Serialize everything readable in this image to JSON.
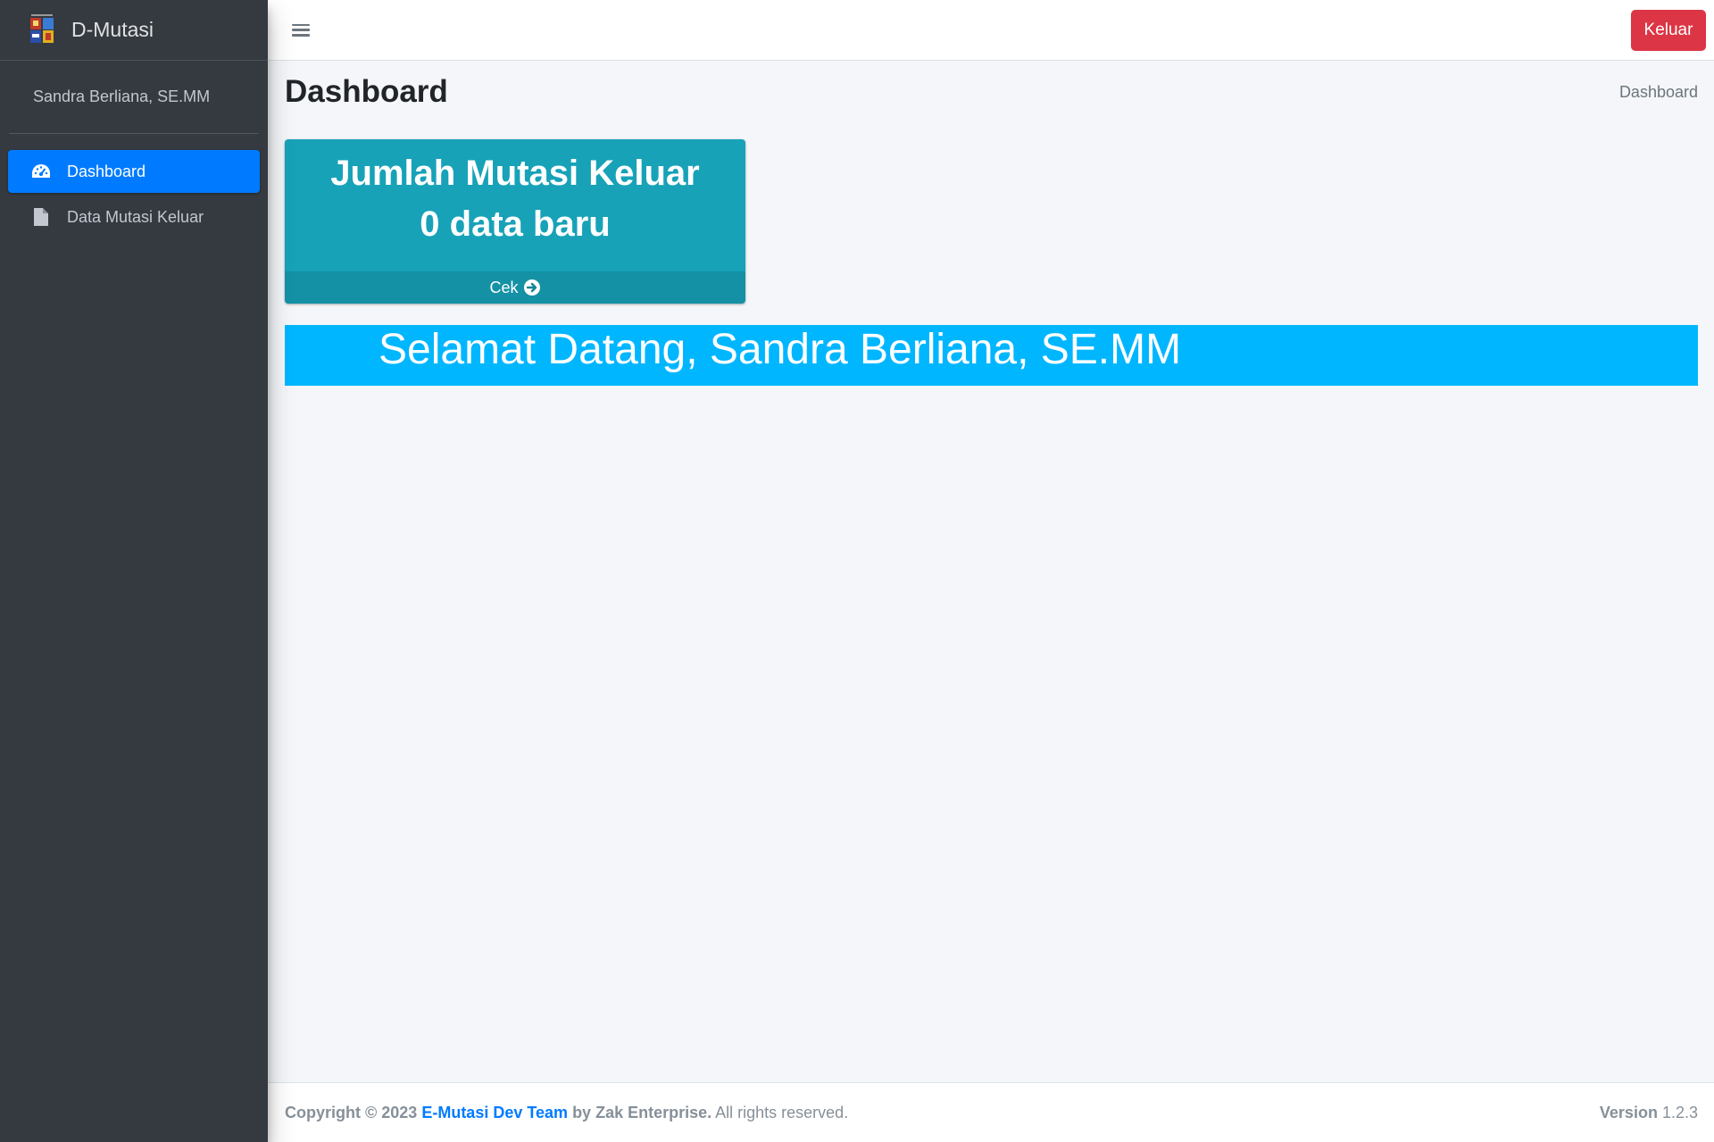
{
  "app": {
    "brand": "D-Mutasi"
  },
  "user": {
    "name": "Sandra Berliana, SE.MM"
  },
  "sidebar": {
    "items": [
      {
        "label": "Dashboard",
        "icon": "tachometer-icon",
        "active": true
      },
      {
        "label": "Data Mutasi Keluar",
        "icon": "file-icon",
        "active": false
      }
    ]
  },
  "topbar": {
    "logout_label": "Keluar"
  },
  "header": {
    "title": "Dashboard",
    "breadcrumb": "Dashboard"
  },
  "stat_box": {
    "title": "Jumlah Mutasi Keluar",
    "value": "0 data baru",
    "link_label": "Cek",
    "color": "#17a2b8"
  },
  "welcome": {
    "text": "Selamat Datang, Sandra Berliana, SE.MM",
    "color": "#00b6ff"
  },
  "footer": {
    "copyright": "Copyright © 2023",
    "team": "E-Mutasi Dev Team",
    "by": "by Zak Enterprise.",
    "rights": "All rights reserved.",
    "version_label": "Version",
    "version": "1.2.3"
  },
  "colors": {
    "sidebar": "#343a40",
    "primary": "#007bff",
    "danger": "#dc3545"
  }
}
